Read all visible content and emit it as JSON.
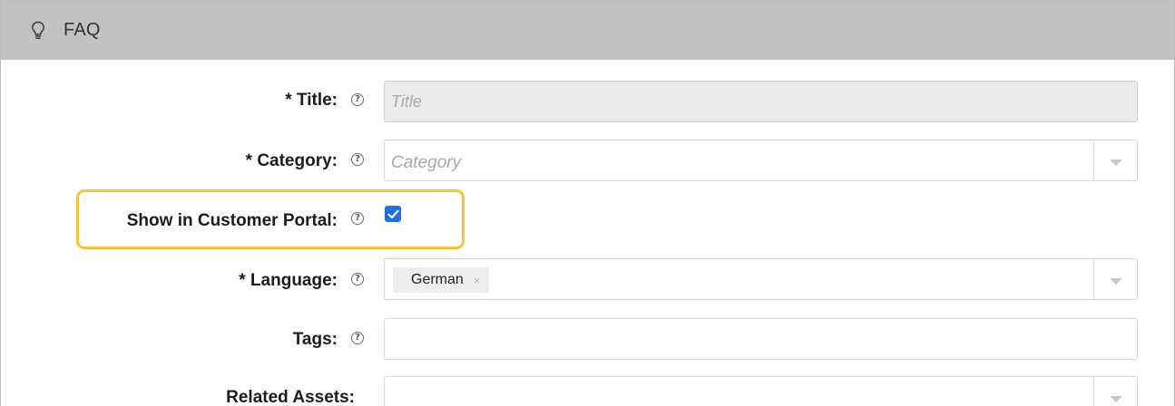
{
  "panel": {
    "title": "FAQ",
    "icon": "lightbulb-icon"
  },
  "form": {
    "title": {
      "label": "* Title:",
      "placeholder": "Title",
      "value": ""
    },
    "category": {
      "label": "* Category:",
      "placeholder": "Category",
      "value": ""
    },
    "show_in_portal": {
      "label": "Show in Customer Portal:",
      "checked": true
    },
    "language": {
      "label": "* Language:",
      "selected": [
        "German"
      ],
      "remove_symbol": "×"
    },
    "tags": {
      "label": "Tags:",
      "value": ""
    },
    "related_assets": {
      "label": "Related Assets:",
      "value": ""
    }
  },
  "help_symbol": "?",
  "colors": {
    "header_bg": "#c2c2c2",
    "highlight": "#f2c53d",
    "checkbox": "#1f6fe0"
  }
}
